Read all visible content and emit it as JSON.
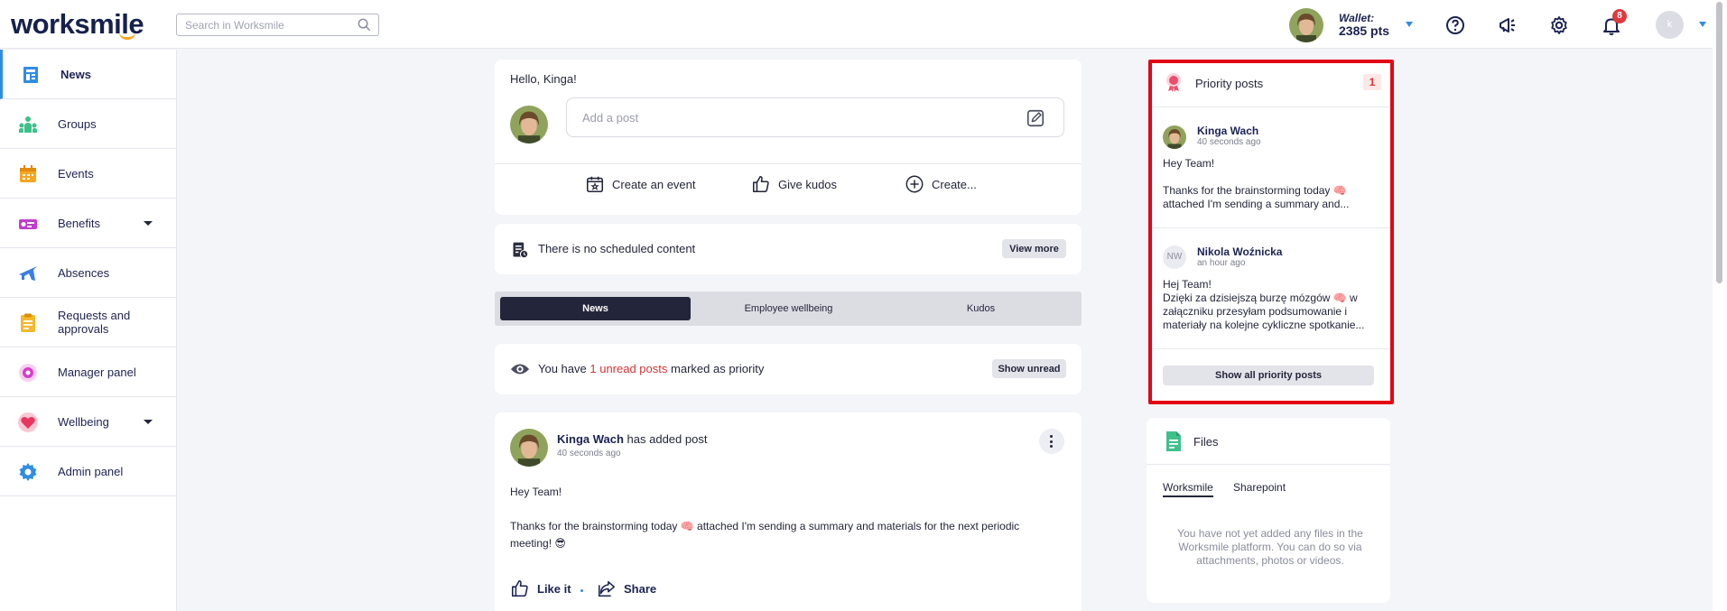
{
  "app": {
    "logo": "worksmile",
    "search_placeholder": "Search in Worksmile"
  },
  "header": {
    "wallet_label": "Wallet:",
    "wallet_points": "2385 pts",
    "notifications_count": "8",
    "user_initial": "k"
  },
  "sidebar": {
    "items": [
      {
        "label": "News",
        "icon": "news-icon",
        "active": true
      },
      {
        "label": "Groups",
        "icon": "groups-icon"
      },
      {
        "label": "Events",
        "icon": "events-icon"
      },
      {
        "label": "Benefits",
        "icon": "benefits-icon",
        "expandable": true
      },
      {
        "label": "Absences",
        "icon": "absences-icon"
      },
      {
        "label": "Requests and approvals",
        "icon": "requests-icon"
      },
      {
        "label": "Manager panel",
        "icon": "manager-icon"
      },
      {
        "label": "Wellbeing",
        "icon": "wellbeing-icon",
        "expandable": true
      },
      {
        "label": "Admin panel",
        "icon": "admin-icon"
      }
    ]
  },
  "composer": {
    "greeting": "Hello, Kinga!",
    "placeholder": "Add a post",
    "actions": [
      "Create an event",
      "Give kudos",
      "Create..."
    ]
  },
  "scheduled": {
    "text": "There is no scheduled content",
    "button": "View more"
  },
  "feed_tabs": [
    "News",
    "Employee wellbeing",
    "Kudos"
  ],
  "unread": {
    "prefix": "You have",
    "link": "1 unread posts",
    "suffix": "marked as priority",
    "button": "Show unread"
  },
  "post": {
    "author": "Kinga Wach",
    "action": "has added post",
    "time": "40 seconds ago",
    "line1": "Hey Team!",
    "line2": "Thanks for the brainstorming today 🧠 attached I'm sending a summary and materials for the next periodic",
    "line3": "meeting! 😎",
    "like": "Like it",
    "share": "Share"
  },
  "priority": {
    "title": "Priority posts",
    "count": "1",
    "posts": [
      {
        "author": "Kinga Wach",
        "time": "40 seconds ago",
        "line1": "Hey Team!",
        "line2": "Thanks for the brainstorming today 🧠",
        "line3": "attached I'm sending a summary and..."
      },
      {
        "initials": "NW",
        "author": "Nikola Woźnicka",
        "time": "an hour ago",
        "line1": "Hej Team!",
        "line2": "Dzięki za dzisiejszą burzę mózgów 🧠 w",
        "line3": "załączniku przesyłam podsumowanie i",
        "line4": "materiały na kolejne cykliczne spotkanie..."
      }
    ],
    "button": "Show all priority posts"
  },
  "files": {
    "title": "Files",
    "tabs": [
      "Worksmile",
      "Sharepoint"
    ],
    "empty": "You have not yet added any files in the Worksmile platform. You can do so via attachments, photos or videos."
  },
  "colors": {
    "accent": "#2f8de4",
    "navy": "#1b2352",
    "priority_red": "#e30613"
  }
}
